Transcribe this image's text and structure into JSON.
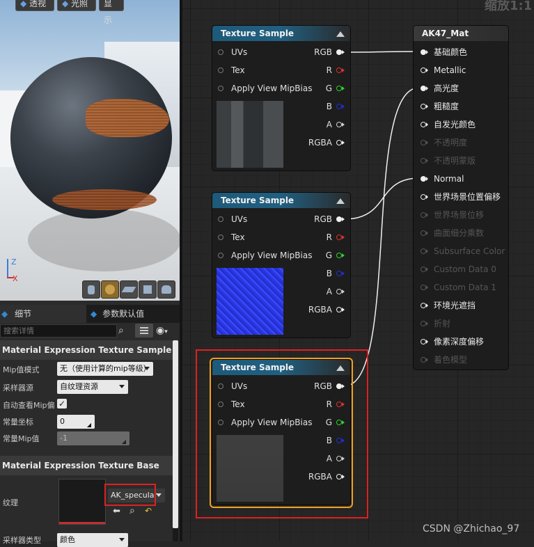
{
  "viewport": {
    "buttons": {
      "perspective": "透视",
      "lit": "光照",
      "show": "显示"
    },
    "axis": {
      "z": "Z",
      "x": "X"
    }
  },
  "details_panel": {
    "tabs": [
      {
        "label": "细节"
      },
      {
        "label": "参数默认值"
      }
    ],
    "search_placeholder": "搜索详情",
    "section1": {
      "title": "Material Expression Texture Sample",
      "props": [
        {
          "label": "Mip值模式",
          "value": "无（使用计算的mip等级）"
        },
        {
          "label": "采样器源",
          "value": "自纹理资源"
        },
        {
          "label": "自动查看Mip偏",
          "value": "checked"
        },
        {
          "label": "常量坐标",
          "value": "0"
        },
        {
          "label": "常量Mip值",
          "value": "-1"
        }
      ]
    },
    "section2": {
      "title": "Material Expression Texture Base",
      "texture_label": "纹理",
      "texture_asset": "AK_specular",
      "sampler_type_label": "采样器类型",
      "sampler_type_value": "颜色"
    }
  },
  "graph": {
    "zoom_label": "缩放1:1",
    "texture_nodes": [
      {
        "title": "Texture Sample",
        "inputs": [
          "UVs",
          "Tex",
          "Apply View MipBias"
        ],
        "outputs": [
          "RGB",
          "R",
          "G",
          "B",
          "A",
          "RGBA"
        ]
      },
      {
        "title": "Texture Sample",
        "inputs": [
          "UVs",
          "Tex",
          "Apply View MipBias"
        ],
        "outputs": [
          "RGB",
          "R",
          "G",
          "B",
          "A",
          "RGBA"
        ]
      },
      {
        "title": "Texture Sample",
        "inputs": [
          "UVs",
          "Tex",
          "Apply View MipBias"
        ],
        "outputs": [
          "RGB",
          "R",
          "G",
          "B",
          "A",
          "RGBA"
        ]
      }
    ],
    "material_node": {
      "title": "AK47_Mat",
      "pins": [
        {
          "label": "基础颜色",
          "enabled": true,
          "connected": true
        },
        {
          "label": "Metallic",
          "enabled": true,
          "connected": false
        },
        {
          "label": "高光度",
          "enabled": true,
          "connected": true
        },
        {
          "label": "粗糙度",
          "enabled": true,
          "connected": false
        },
        {
          "label": "自发光颜色",
          "enabled": true,
          "connected": false
        },
        {
          "label": "不透明度",
          "enabled": false,
          "connected": false
        },
        {
          "label": "不透明蒙版",
          "enabled": false,
          "connected": false
        },
        {
          "label": "Normal",
          "enabled": true,
          "connected": true
        },
        {
          "label": "世界场景位置偏移",
          "enabled": true,
          "connected": false
        },
        {
          "label": "世界场景位移",
          "enabled": false,
          "connected": false
        },
        {
          "label": "曲面细分乘数",
          "enabled": false,
          "connected": false
        },
        {
          "label": "Subsurface Color",
          "enabled": false,
          "connected": false
        },
        {
          "label": "Custom Data 0",
          "enabled": false,
          "connected": false
        },
        {
          "label": "Custom Data 1",
          "enabled": false,
          "connected": false
        },
        {
          "label": "环境光遮挡",
          "enabled": true,
          "connected": false
        },
        {
          "label": "折射",
          "enabled": false,
          "connected": false
        },
        {
          "label": "像素深度偏移",
          "enabled": true,
          "connected": false
        },
        {
          "label": "着色模型",
          "enabled": false,
          "connected": false
        }
      ]
    },
    "watermark": "CSDN @Zhichao_97",
    "colors": {
      "highlight": "#e02020",
      "selected": "#f0a020",
      "tex_header": "#1e5a7a"
    }
  }
}
